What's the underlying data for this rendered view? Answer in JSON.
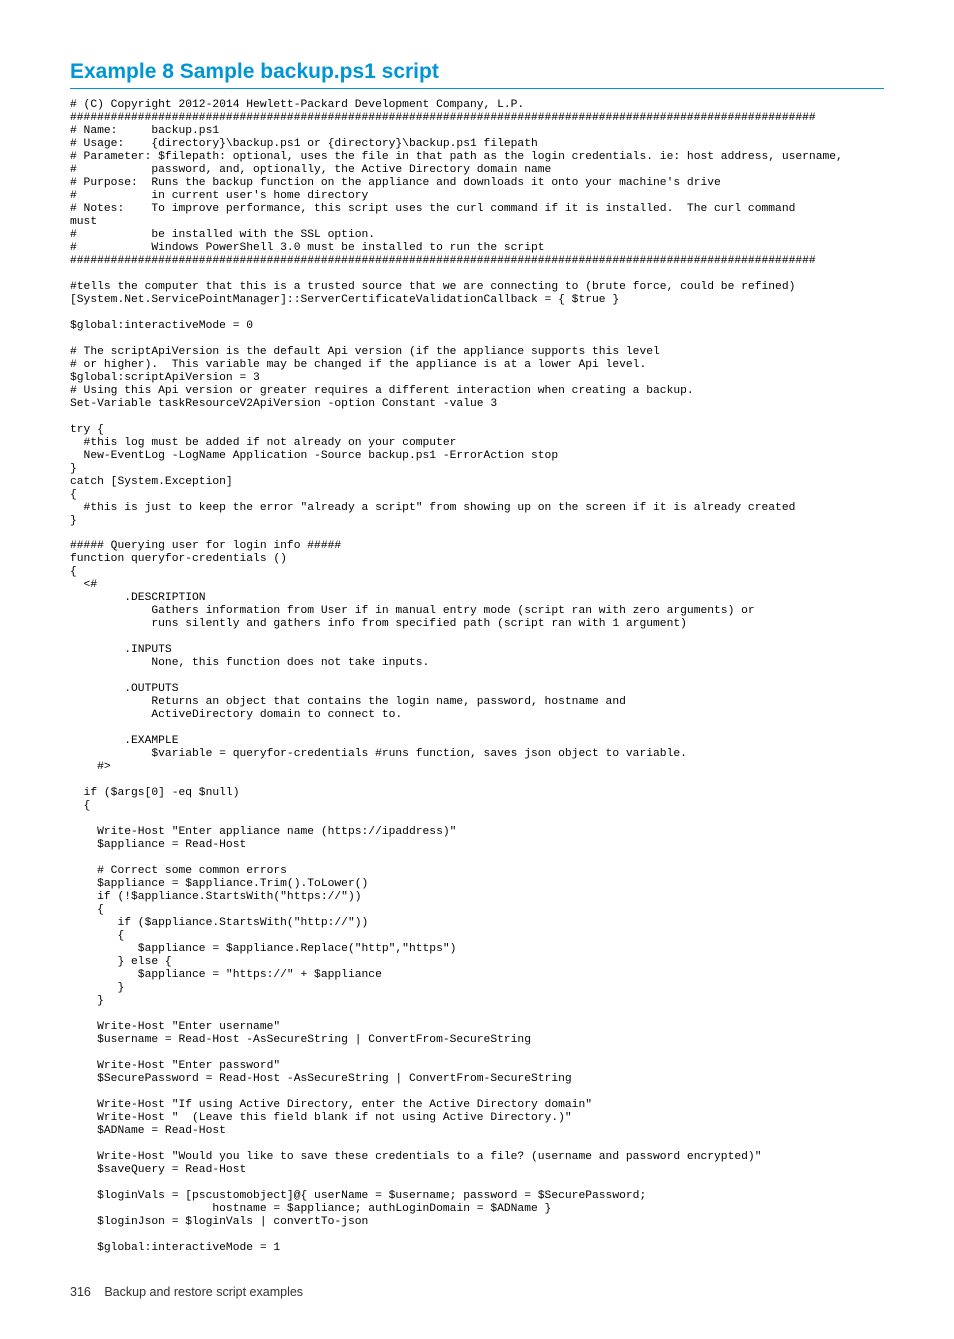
{
  "heading": "Example 8 Sample backup.ps1 script",
  "code": "# (C) Copyright 2012-2014 Hewlett-Packard Development Company, L.P.\n##############################################################################################################\n# Name:     backup.ps1\n# Usage:    {directory}\\backup.ps1 or {directory}\\backup.ps1 filepath\n# Parameter: $filepath: optional, uses the file in that path as the login credentials. ie: host address, username,\n#           password, and, optionally, the Active Directory domain name\n# Purpose:  Runs the backup function on the appliance and downloads it onto your machine's drive\n#           in current user's home directory\n# Notes:    To improve performance, this script uses the curl command if it is installed.  The curl command\nmust\n#           be installed with the SSL option.\n#           Windows PowerShell 3.0 must be installed to run the script\n##############################################################################################################\n\n#tells the computer that this is a trusted source that we are connecting to (brute force, could be refined)\n[System.Net.ServicePointManager]::ServerCertificateValidationCallback = { $true }\n\n$global:interactiveMode = 0\n\n# The scriptApiVersion is the default Api version (if the appliance supports this level\n# or higher).  This variable may be changed if the appliance is at a lower Api level.\n$global:scriptApiVersion = 3\n# Using this Api version or greater requires a different interaction when creating a backup.\nSet-Variable taskResourceV2ApiVersion -option Constant -value 3\n\ntry {\n  #this log must be added if not already on your computer\n  New-EventLog -LogName Application -Source backup.ps1 -ErrorAction stop\n}\ncatch [System.Exception]\n{\n  #this is just to keep the error \"already a script\" from showing up on the screen if it is already created\n}\n\n##### Querying user for login info #####\nfunction queryfor-credentials ()\n{\n  <#\n        .DESCRIPTION\n            Gathers information from User if in manual entry mode (script ran with zero arguments) or\n            runs silently and gathers info from specified path (script ran with 1 argument)\n\n        .INPUTS\n            None, this function does not take inputs.\n\n        .OUTPUTS\n            Returns an object that contains the login name, password, hostname and\n            ActiveDirectory domain to connect to.\n\n        .EXAMPLE\n            $variable = queryfor-credentials #runs function, saves json object to variable.\n    #>\n\n  if ($args[0] -eq $null)\n  {\n\n    Write-Host \"Enter appliance name (https://ipaddress)\"\n    $appliance = Read-Host\n\n    # Correct some common errors\n    $appliance = $appliance.Trim().ToLower()\n    if (!$appliance.StartsWith(\"https://\"))\n    {\n       if ($appliance.StartsWith(\"http://\"))\n       {\n          $appliance = $appliance.Replace(\"http\",\"https\")\n       } else {\n          $appliance = \"https://\" + $appliance\n       }\n    }\n\n    Write-Host \"Enter username\"\n    $username = Read-Host -AsSecureString | ConvertFrom-SecureString\n\n    Write-Host \"Enter password\"\n    $SecurePassword = Read-Host -AsSecureString | ConvertFrom-SecureString\n\n    Write-Host \"If using Active Directory, enter the Active Directory domain\"\n    Write-Host \"  (Leave this field blank if not using Active Directory.)\"\n    $ADName = Read-Host\n\n    Write-Host \"Would you like to save these credentials to a file? (username and password encrypted)\"\n    $saveQuery = Read-Host\n\n    $loginVals = [pscustomobject]@{ userName = $username; password = $SecurePassword;\n                     hostname = $appliance; authLoginDomain = $ADName }\n    $loginJson = $loginVals | convertTo-json\n\n    $global:interactiveMode = 1",
  "footer": {
    "page": "316",
    "text": "Backup and restore script examples"
  }
}
